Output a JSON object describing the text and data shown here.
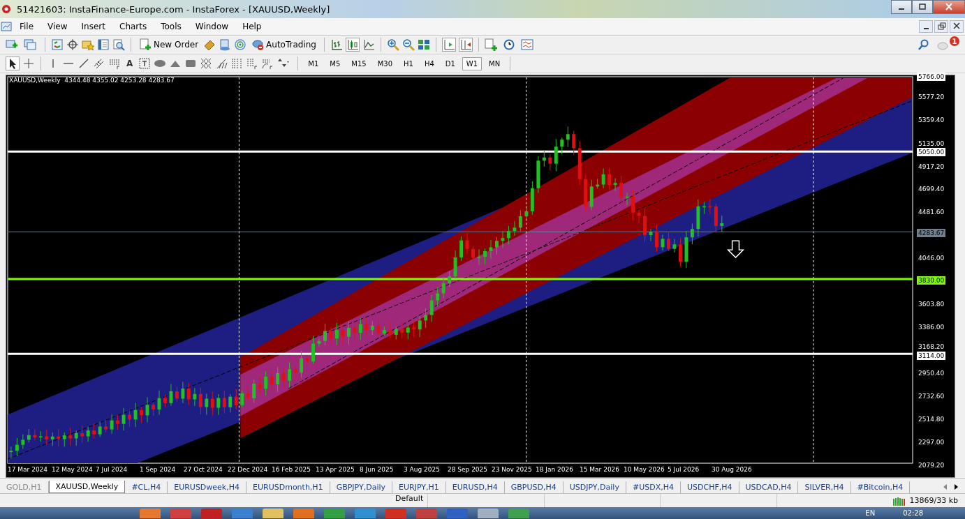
{
  "window": {
    "title": "51421603: InstaFinance-Europe.com - InstaForex - [XAUUSD,Weekly]"
  },
  "menu": [
    "File",
    "View",
    "Insert",
    "Charts",
    "Tools",
    "Window",
    "Help"
  ],
  "toolbar": {
    "new_order": "New Order",
    "auto_trading": "AutoTrading",
    "notifications": "1"
  },
  "drawing_tools": {
    "text_tool": "A"
  },
  "timeframes": [
    {
      "label": "M1",
      "selected": false
    },
    {
      "label": "M5",
      "selected": false
    },
    {
      "label": "M15",
      "selected": false
    },
    {
      "label": "M30",
      "selected": false
    },
    {
      "label": "H1",
      "selected": false
    },
    {
      "label": "H4",
      "selected": false
    },
    {
      "label": "D1",
      "selected": false
    },
    {
      "label": "W1",
      "selected": true
    },
    {
      "label": "MN",
      "selected": false
    }
  ],
  "chart": {
    "header": "XAUUSD,Weekly  4344.48 4355.02 4253.28 4283.67",
    "price_scale": [
      {
        "label": "5766.00",
        "kind": "top"
      },
      {
        "label": "5577.20",
        "kind": "tick"
      },
      {
        "label": "5359.40",
        "kind": "tick"
      },
      {
        "label": "5135.00",
        "kind": "tick"
      },
      {
        "label": "5050.00",
        "kind": "level",
        "color": "#ffffff"
      },
      {
        "label": "4917.20",
        "kind": "tick"
      },
      {
        "label": "4699.40",
        "kind": "tick"
      },
      {
        "label": "4481.60",
        "kind": "tick"
      },
      {
        "label": "4283.67",
        "kind": "bid",
        "color": "#708090"
      },
      {
        "label": "4046.00",
        "kind": "tick"
      },
      {
        "label": "3830.00",
        "kind": "level",
        "color": "#7cfc00"
      },
      {
        "label": "3603.80",
        "kind": "tick"
      },
      {
        "label": "3386.00",
        "kind": "tick"
      },
      {
        "label": "3168.20",
        "kind": "tick"
      },
      {
        "label": "3114.00",
        "kind": "level",
        "color": "#ffffff"
      },
      {
        "label": "2950.40",
        "kind": "tick"
      },
      {
        "label": "2732.60",
        "kind": "tick"
      },
      {
        "label": "2514.80",
        "kind": "tick"
      },
      {
        "label": "2297.00",
        "kind": "tick"
      },
      {
        "label": "2079.20",
        "kind": "tick"
      }
    ],
    "time_scale": [
      "17 Mar 2024",
      "12 May 2024",
      "7 Jul 2024",
      "1 Sep 2024",
      "27 Oct 2024",
      "22 Dec 2024",
      "16 Feb 2025",
      "13 Apr 2025",
      "8 Jun 2025",
      "3 Aug 2025",
      "28 Sep 2025",
      "23 Nov 2025",
      "18 Jan 2026",
      "15 Mar 2026",
      "10 May 2026",
      "5 Jul 2026",
      "30 Aug 2026"
    ]
  },
  "chart_tabs": [
    {
      "label": "GOLD,H1",
      "selected": false
    },
    {
      "label": "XAUUSD,Weekly",
      "selected": true
    },
    {
      "label": "#CL,H4",
      "selected": false
    },
    {
      "label": "EURUSDweek,H4",
      "selected": false
    },
    {
      "label": "EURUSDmonth,H1",
      "selected": false
    },
    {
      "label": "GBPJPY,Daily",
      "selected": false
    },
    {
      "label": "EURJPY,H1",
      "selected": false
    },
    {
      "label": "EURUSD,H4",
      "selected": false
    },
    {
      "label": "GBPUSD,H4",
      "selected": false
    },
    {
      "label": "USDJPY,Daily",
      "selected": false
    },
    {
      "label": "#USDX,H4",
      "selected": false
    },
    {
      "label": "USDCHF,H4",
      "selected": false
    },
    {
      "label": "USDCAD,H4",
      "selected": false
    },
    {
      "label": "SILVER,H4",
      "selected": false
    },
    {
      "label": "#Bitcoin,H4",
      "selected": false
    }
  ],
  "status_bar": {
    "profile": "Default",
    "traffic": "13869/33 kb"
  },
  "taskbar": {
    "language": "EN",
    "clock": "02:28"
  }
}
